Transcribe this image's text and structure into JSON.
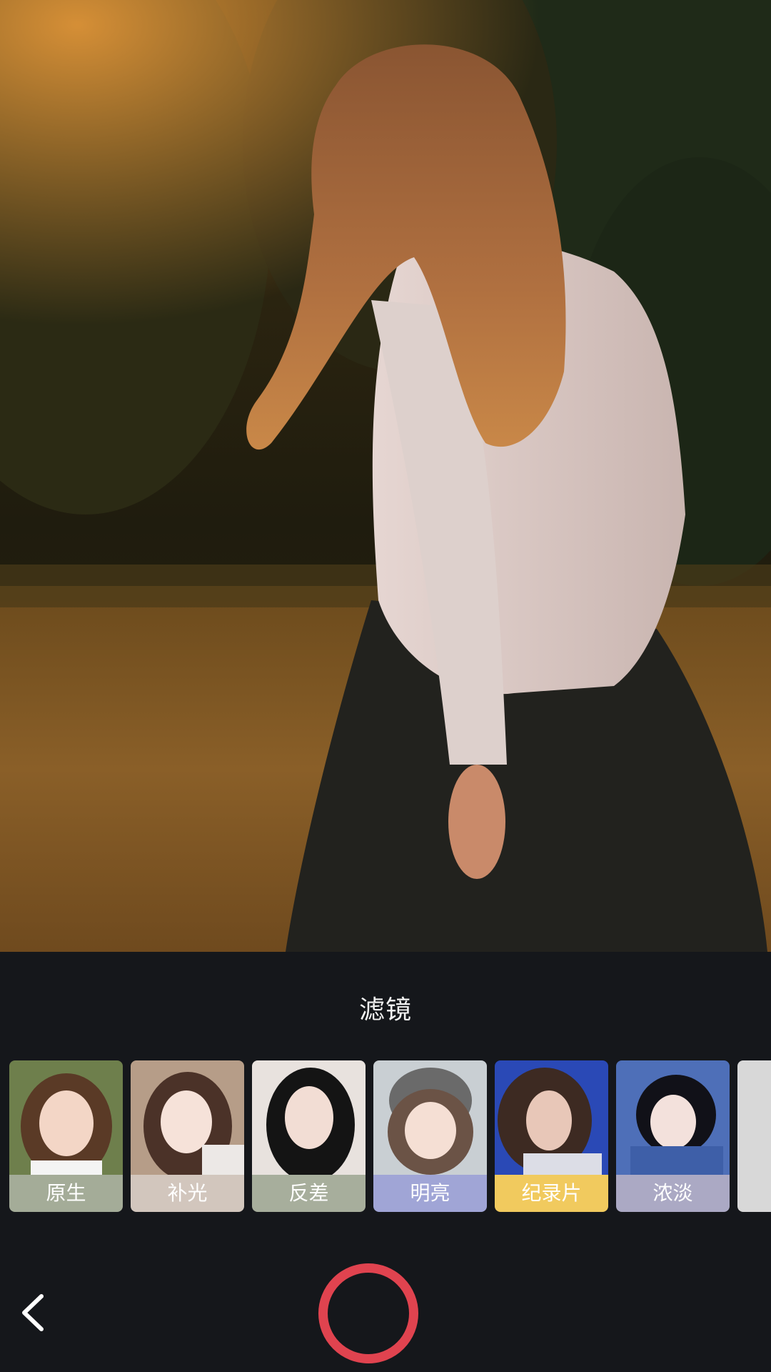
{
  "panel": {
    "title": "滤镜"
  },
  "filters": [
    {
      "label": "原生",
      "label_color": "#a4ac98",
      "thumb_bg": "#6e7f4c",
      "hair": "#5a3a26",
      "skin": "#f3d6c6"
    },
    {
      "label": "补光",
      "label_color": "#d2c6bd",
      "thumb_bg": "#b69d88",
      "hair": "#4b3228",
      "skin": "#f6e2d9"
    },
    {
      "label": "反差",
      "label_color": "#a7ae9c",
      "thumb_bg": "#e8e2de",
      "hair": "#141414",
      "skin": "#f2ddd4"
    },
    {
      "label": "明亮",
      "label_color": "#a0a5d6",
      "thumb_bg": "#c9cfd3",
      "hair": "#6b5346",
      "skin": "#f5dfd4"
    },
    {
      "label": "纪录片",
      "label_color": "#f1ca5e",
      "thumb_bg": "#2a49b6",
      "hair": "#3d2a22",
      "skin": "#e8c7b8"
    },
    {
      "label": "浓淡",
      "label_color": "#aba9c4",
      "thumb_bg": "#4e6fb8",
      "hair": "#111118",
      "skin": "#f3e1dc"
    }
  ],
  "controls": {
    "back_icon": "chevron-left-icon",
    "shutter_color": "#e0434f"
  }
}
